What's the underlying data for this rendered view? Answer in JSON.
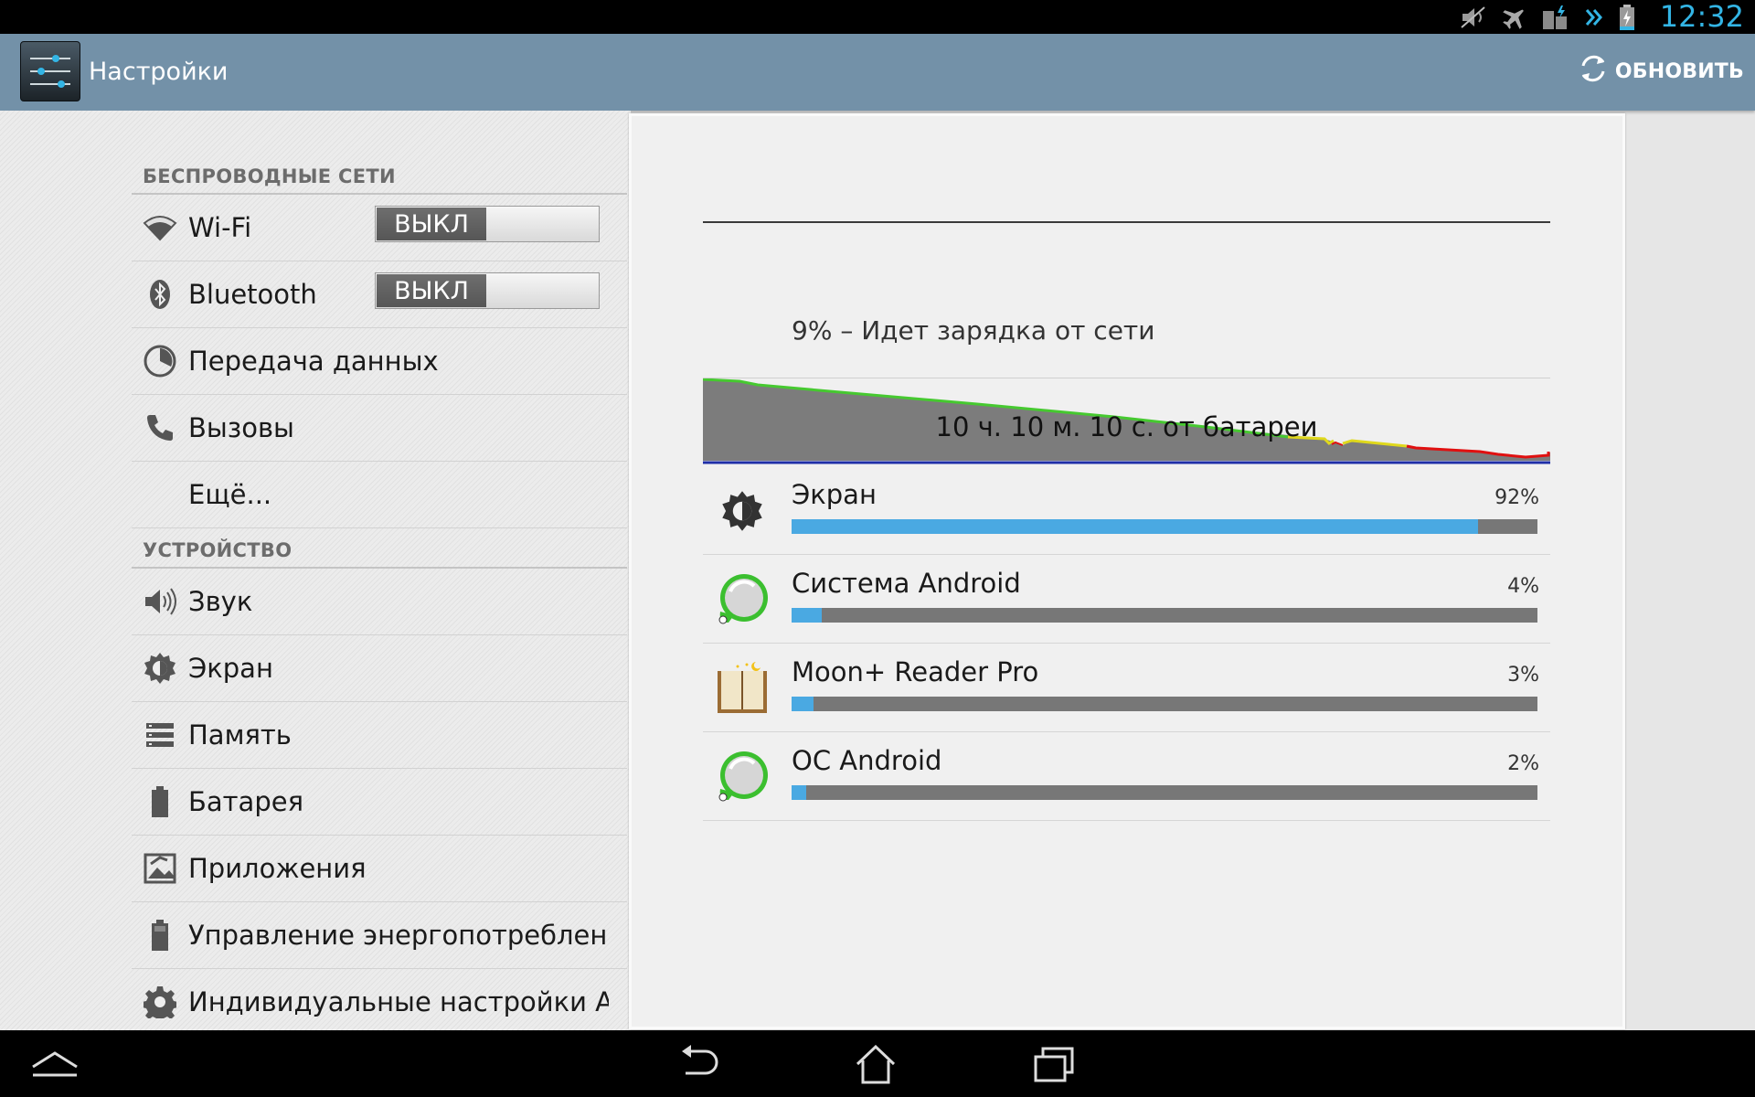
{
  "status_bar": {
    "clock": "12:32",
    "icons": [
      "mute-icon",
      "airplane-mode-icon",
      "battery-saver-icon",
      "overflow-arrows-icon",
      "battery-charging-icon"
    ]
  },
  "action_bar": {
    "app_icon": "settings-sliders-icon",
    "title": "Настройки",
    "refresh_label": "ОБНОВИТЬ"
  },
  "settings_list": {
    "sections": [
      {
        "header": "БЕСПРОВОДНЫЕ СЕТИ",
        "items": [
          {
            "label": "Wi-Fi",
            "icon": "wifi-icon",
            "toggle": "ВЫКЛ"
          },
          {
            "label": "Bluetooth",
            "icon": "bluetooth-icon",
            "toggle": "ВЫКЛ"
          },
          {
            "label": "Передача данных",
            "icon": "data-usage-icon"
          },
          {
            "label": "Вызовы",
            "icon": "phone-icon"
          },
          {
            "label": "Ещё...",
            "icon": ""
          }
        ]
      },
      {
        "header": "УСТРОЙСТВО",
        "items": [
          {
            "label": "Звук",
            "icon": "speaker-icon"
          },
          {
            "label": "Экран",
            "icon": "brightness-icon"
          },
          {
            "label": "Память",
            "icon": "storage-icon"
          },
          {
            "label": "Батарея",
            "icon": "battery-icon"
          },
          {
            "label": "Приложения",
            "icon": "apps-icon"
          },
          {
            "label": "Управление энергопотреблени",
            "icon": "power-management-icon"
          },
          {
            "label": "Индивидуальные настройки A",
            "icon": "gear-icon"
          }
        ]
      }
    ]
  },
  "battery": {
    "summary": "9% – Идет зарядка от сети",
    "graph_label": "10 ч. 10 м. 10 с. от батареи",
    "usage": [
      {
        "name": "Экран",
        "percent_label": "92%",
        "percent": 92,
        "icon": "brightness-icon"
      },
      {
        "name": "Система Android",
        "percent_label": "4%",
        "percent": 4,
        "icon": "android-system-icon"
      },
      {
        "name": "Moon+ Reader Pro",
        "percent_label": "3%",
        "percent": 3,
        "icon": "book-icon"
      },
      {
        "name": "ОС Android",
        "percent_label": "2%",
        "percent": 2,
        "icon": "android-os-icon"
      }
    ]
  },
  "navigation_bar": {
    "buttons": [
      "up-chevron-icon",
      "back-icon",
      "home-icon",
      "recent-apps-icon"
    ]
  },
  "colors": {
    "action_bar": "#7391a8",
    "accent": "#33b5e5",
    "usage_bar_fill": "#4aa9e2",
    "usage_bar_track": "#777777"
  }
}
